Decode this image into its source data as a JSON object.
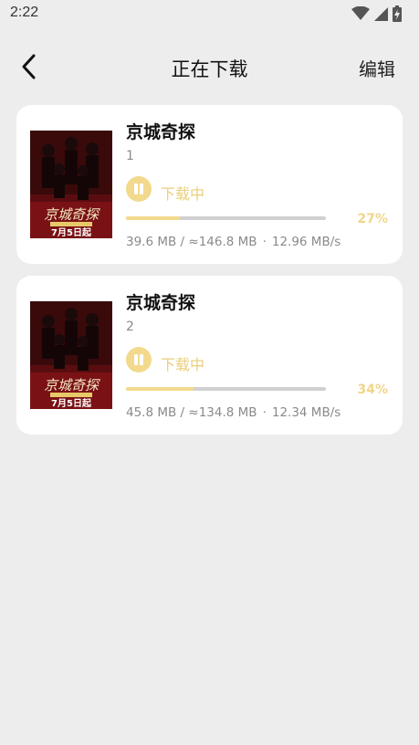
{
  "status_bar": {
    "time": "2:22"
  },
  "nav": {
    "title": "正在下载",
    "edit_label": "编辑"
  },
  "tasks": [
    {
      "title": "京城奇探",
      "episode": "1",
      "status": "下载中",
      "progress": 0.27,
      "percent_label": "27%",
      "downloaded": "39.6 MB / ≈146.8 MB",
      "separator": "·",
      "speed": "12.96 MB/s",
      "poster": {
        "title": "京城奇探",
        "date": "7月5日起"
      }
    },
    {
      "title": "京城奇探",
      "episode": "2",
      "status": "下载中",
      "progress": 0.34,
      "percent_label": "34%",
      "downloaded": "45.8 MB / ≈134.8 MB",
      "separator": "·",
      "speed": "12.34 MB/s",
      "poster": {
        "title": "京城奇探",
        "date": "7月5日起"
      }
    }
  ],
  "colors": {
    "accent": "#f2d98c",
    "background": "#ededed",
    "card": "#ffffff"
  }
}
